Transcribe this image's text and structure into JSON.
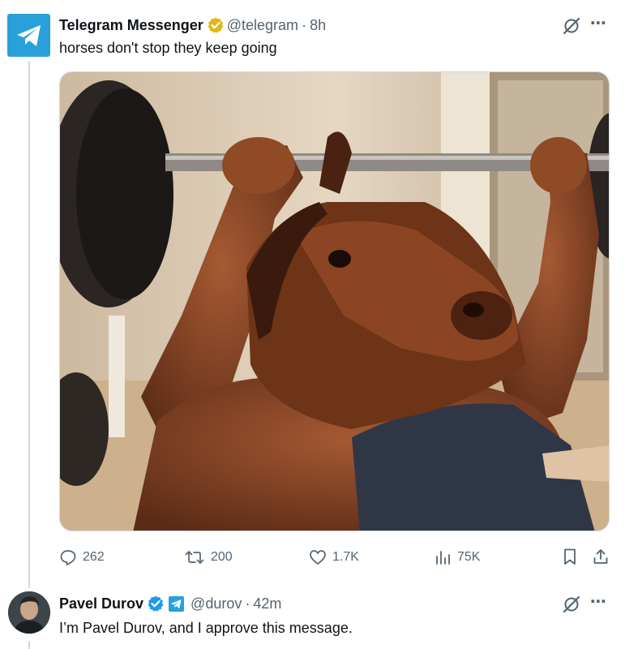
{
  "tweet": {
    "author_name": "Telegram Messenger",
    "handle": "@telegram",
    "separator": "·",
    "time": "8h",
    "text": "horses don't stop they keep going",
    "stats": {
      "replies": "262",
      "reposts": "200",
      "likes": "1.7K",
      "views": "75K"
    }
  },
  "reply": {
    "author_name": "Pavel Durov",
    "handle": "@durov",
    "separator": "·",
    "time": "42m",
    "text": "I’m Pavel Durov, and I approve this message."
  },
  "colors": {
    "telegram_blue": "#2aa0da",
    "gold_verified": "#e2b719",
    "blue_verified": "#1d9bf0",
    "secondary_text": "#536471"
  },
  "icons": {
    "more": "⋯"
  }
}
